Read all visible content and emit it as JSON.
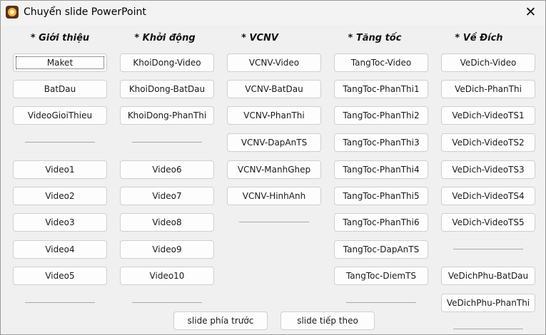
{
  "window": {
    "title": "Chuyển slide PowerPoint"
  },
  "icons": {
    "app": "app-logo-icon",
    "close": "close-icon"
  },
  "columns": [
    {
      "header": "* Giới thiệu",
      "buttons": [
        "Maket",
        "BatDau",
        "VideoGioiThieu",
        "Video1",
        "Video2",
        "Video3",
        "Video4",
        "Video5"
      ]
    },
    {
      "header": "* Khởi động",
      "buttons": [
        "KhoiDong-Video",
        "KhoiDong-BatDau",
        "KhoiDong-PhanThi",
        "Video6",
        "Video7",
        "Video8",
        "Video9",
        "Video10"
      ]
    },
    {
      "header": "* VCNV",
      "buttons": [
        "VCNV-Video",
        "VCNV-BatDau",
        "VCNV-PhanThi",
        "VCNV-DapAnTS",
        "VCNV-ManhGhep",
        "VCNV-HinhAnh"
      ]
    },
    {
      "header": "* Tăng tốc",
      "buttons": [
        "TangToc-Video",
        "TangToc-PhanThi1",
        "TangToc-PhanThi2",
        "TangToc-PhanThi3",
        "TangToc-PhanThi4",
        "TangToc-PhanThi5",
        "TangToc-PhanThi6",
        "TangToc-DapAnTS",
        "TangToc-DiemTS"
      ]
    },
    {
      "header": "* Về Đích",
      "buttons": [
        "VeDich-Video",
        "VeDich-PhanThi",
        "VeDich-VideoTS1",
        "VeDich-VideoTS2",
        "VeDich-VideoTS3",
        "VeDich-VideoTS4",
        "VeDich-VideoTS5",
        "VeDichPhu-BatDau",
        "VeDichPhu-PhanThi"
      ]
    }
  ],
  "nav": {
    "prev": "slide phía trước",
    "next": "slide tiếp theo"
  }
}
